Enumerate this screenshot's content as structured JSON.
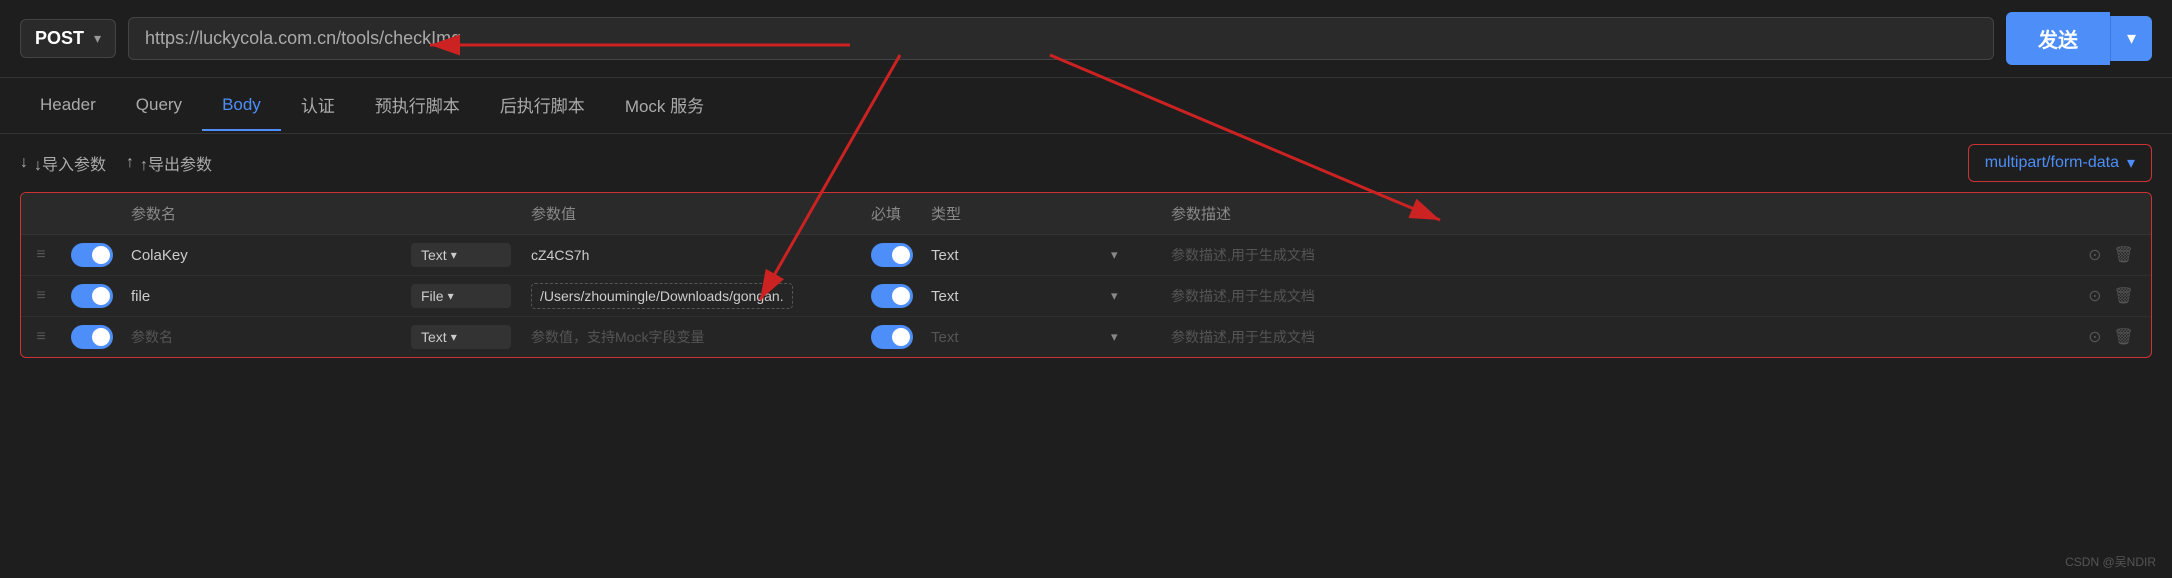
{
  "topbar": {
    "method": "POST",
    "url": "https://luckycola.com.cn/tools/checkImg",
    "send_label": "发送"
  },
  "tabs": [
    {
      "id": "header",
      "label": "Header"
    },
    {
      "id": "query",
      "label": "Query"
    },
    {
      "id": "body",
      "label": "Body",
      "active": true
    },
    {
      "id": "auth",
      "label": "认证"
    },
    {
      "id": "pre_script",
      "label": "预执行脚本"
    },
    {
      "id": "post_script",
      "label": "后执行脚本"
    },
    {
      "id": "mock",
      "label": "Mock 服务"
    }
  ],
  "toolbar": {
    "import_label": "↓导入参数",
    "export_label": "↑导出参数",
    "content_type": "multipart/form-data"
  },
  "table": {
    "headers": [
      "",
      "",
      "参数名",
      "",
      "参数值",
      "必填",
      "类型",
      "",
      "参数描述",
      ""
    ],
    "rows": [
      {
        "enabled": true,
        "name": "ColaKey",
        "name_type": "Text",
        "value": "cZ4CS7h",
        "required": true,
        "type": "Text",
        "description": "参数描述,用于生成文档"
      },
      {
        "enabled": true,
        "name": "file",
        "name_type": "File",
        "value": "/Users/zhoumingle/Downloads/gongan.",
        "value_dashed": true,
        "required": true,
        "type": "Text",
        "description": "参数描述,用于生成文档"
      },
      {
        "enabled": true,
        "name": "",
        "name_placeholder": "参数名",
        "name_type": "Text",
        "value": "",
        "value_placeholder": "参数值，支持Mock字段变量",
        "required": true,
        "type": "Text",
        "description": "参数描述,用于生成文档"
      }
    ]
  },
  "watermark": "CSDN @吴NDIR"
}
